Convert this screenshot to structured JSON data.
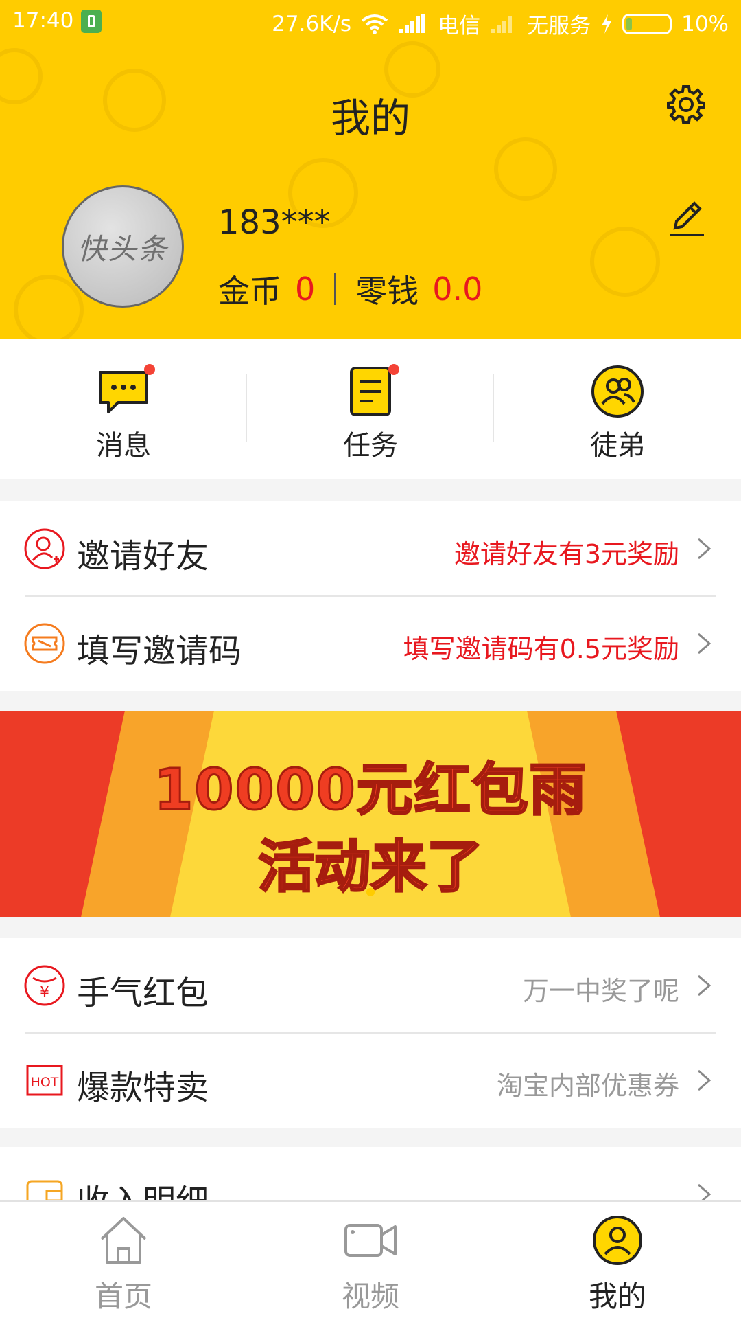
{
  "status_bar": {
    "time": "17:40",
    "speed": "27.6K/s",
    "carrier": "电信",
    "service": "无服务",
    "battery": "10%"
  },
  "header": {
    "title": "我的",
    "avatar_text": "快头条",
    "username": "183***",
    "coins_label": "金币",
    "coins_value": "0",
    "change_label": "零钱",
    "change_value": "0.0"
  },
  "quick_actions": [
    {
      "label": "消息",
      "icon": "message-icon",
      "has_dot": true
    },
    {
      "label": "任务",
      "icon": "task-icon",
      "has_dot": true
    },
    {
      "label": "徒弟",
      "icon": "apprentice-icon",
      "has_dot": false
    }
  ],
  "invite_section": [
    {
      "label": "邀请好友",
      "subtitle": "邀请好友有3元奖励",
      "icon": "invite-friend-icon"
    },
    {
      "label": "填写邀请码",
      "subtitle": "填写邀请码有0.5元奖励",
      "icon": "invite-code-icon"
    }
  ],
  "banner": {
    "line1": "10000元红包雨",
    "line2": "活动来了"
  },
  "promo_section": [
    {
      "label": "手气红包",
      "subtitle": "万一中奖了呢",
      "icon": "red-packet-icon"
    },
    {
      "label": "爆款特卖",
      "subtitle": "淘宝内部优惠券",
      "icon": "hot-icon"
    }
  ],
  "income_row": {
    "label": "收入明细",
    "icon": "wallet-icon"
  },
  "tab_bar": [
    {
      "label": "首页",
      "icon": "home-icon",
      "active": false
    },
    {
      "label": "视频",
      "icon": "video-icon",
      "active": false
    },
    {
      "label": "我的",
      "icon": "profile-icon",
      "active": true
    }
  ],
  "colors": {
    "brand_yellow": "#ffcc00",
    "accent_red": "#e8181f",
    "muted_text": "#999999"
  }
}
